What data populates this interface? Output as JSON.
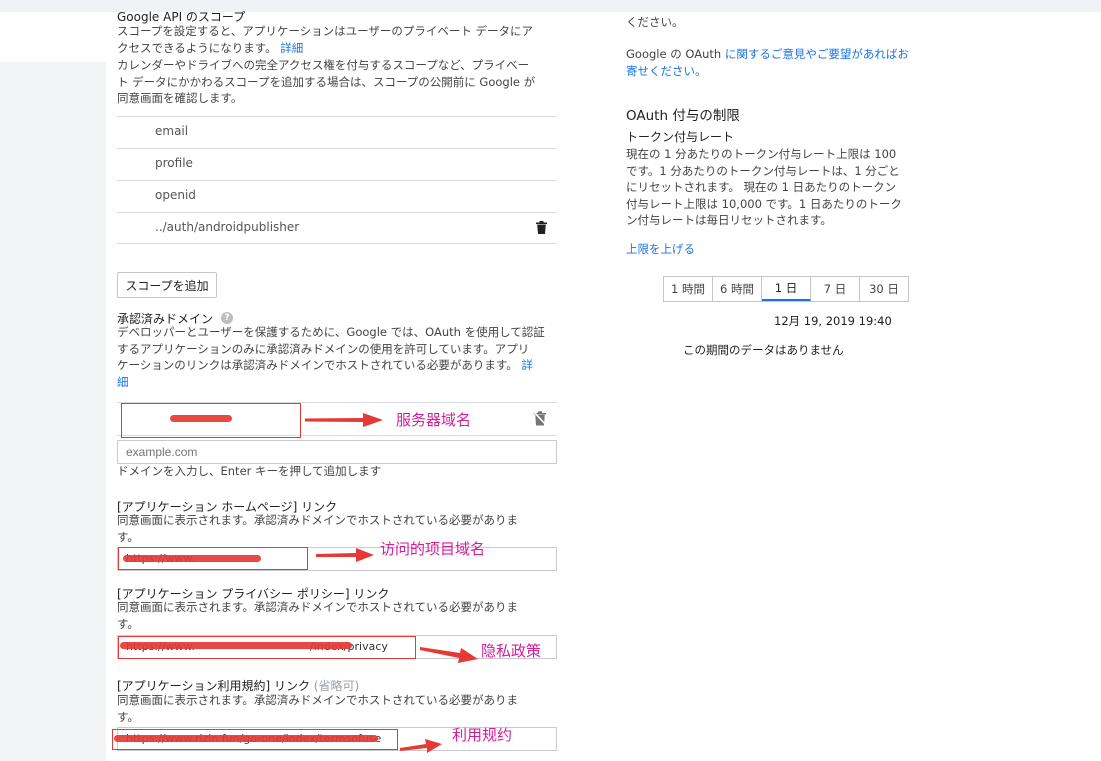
{
  "scopes_section": {
    "title": "Google API のスコープ",
    "desc_lines": [
      "スコープを設定すると、アプリケーションはユーザーのプライベート データにア",
      "クセスできるようになります。"
    ],
    "detail_link": "詳細",
    "desc2_lines": [
      "カレンダーやドライブへの完全アクセス権を付与するスコープなど、プライベー",
      "ト データにかかわるスコープを追加する場合は、スコープの公開前に Google が",
      "同意画面を確認します。"
    ],
    "scopes": [
      "email",
      "profile",
      "openid",
      "../auth/androidpublisher"
    ],
    "add_scope_button": "スコープを追加"
  },
  "domains_section": {
    "title": "承認済みドメイン",
    "desc_lines": [
      "デベロッパーとユーザーを保護するために、Google では、OAuth を使用して認証",
      "するアプリケーションのみに承認済みドメインの使用を許可しています。アプリ",
      "ケーションのリンクは承認済みドメインでホストされている必要があります。"
    ],
    "detail_link_1": "詳",
    "detail_link_2": "細",
    "input_placeholder": "example.com",
    "hint": "ドメインを入力し、Enter キーを押して追加します",
    "annotation": "服务器域名"
  },
  "homepage_section": {
    "title": "[アプリケーション ホームページ] リンク",
    "desc_lines": [
      "同意画面に表示されます。承認済みドメインでホストされている必要がありま",
      "す。"
    ],
    "value": "https://www.",
    "annotation": "访问的项目域名"
  },
  "privacy_section": {
    "title": "[アプリケーション プライバシー ポリシー] リンク",
    "desc_lines": [
      "同意画面に表示されます。承認済みドメインでホストされている必要がありま",
      "す。"
    ],
    "value": "https://www.",
    "value_tail": "/index/privacy",
    "annotation": "隐私政策"
  },
  "terms_section": {
    "title": "[アプリケーション利用規約] リンク",
    "optional": "(省略可)",
    "desc_lines": [
      "同意画面に表示されます。承認済みドメインでホストされている必要がありま",
      "す。"
    ],
    "value": "https://www.rizin.fun/go-one/index/termsofuse",
    "annotation": "利用规约"
  },
  "right_panel": {
    "top_fragment": "ください。",
    "feedback_text_1": "Google の OAuth ",
    "feedback_link_1": "に関するご意見やご要望があれば",
    "feedback_link_2": "お",
    "feedback_link_3": "寄せください。",
    "limits_title": "OAuth 付与の制限",
    "rate_title": "トークン付与レート",
    "rate_desc_lines": [
      "現在の 1 分あたりのトークン付与レート上限は 100",
      "です。1 分あたりのトークン付与レートは、1 分ごと",
      "にリセットされます。 現在の 1 日あたりのトークン",
      "付与レート上限は 10,000 です。1 日あたりのトーク",
      "ン付与レートは毎日リセットされます。"
    ],
    "raise_limit_link": "上限を上げる",
    "time_tabs": [
      "1 時間",
      "6 時間",
      "1 日",
      "7 日",
      "30 日"
    ],
    "active_tab": "1 日",
    "timestamp": "12月 19, 2019 19:40",
    "no_data": "この期間のデータはありません"
  },
  "colors": {
    "link": "#1a73e8",
    "annotation": "#d21e9a",
    "annotation_box": "#e53935"
  }
}
